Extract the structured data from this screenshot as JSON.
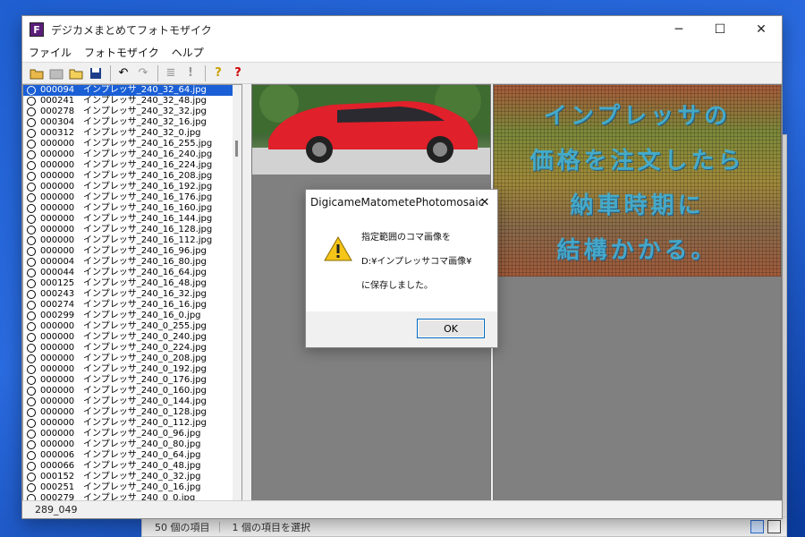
{
  "background": {
    "status_count": "50 個の項目",
    "status_selected": "1 個の項目を選択"
  },
  "window": {
    "title": "デジカメまとめてフォトモザイク",
    "icon_letter": "F"
  },
  "menu": [
    "ファイル",
    "フォトモザイク",
    "ヘルプ"
  ],
  "toolbar_icons": [
    "open-folder-icon",
    "image-folder-icon",
    "folder-icon",
    "save-icon",
    "undo-icon",
    "redo-icon",
    "list-icon",
    "exclamation-icon",
    "help-icon",
    "context-help-icon"
  ],
  "list": [
    {
      "num": "000094",
      "name": "インプレッサ_240_32_64.jpg",
      "selected": true
    },
    {
      "num": "000241",
      "name": "インプレッサ_240_32_48.jpg"
    },
    {
      "num": "000278",
      "name": "インプレッサ_240_32_32.jpg"
    },
    {
      "num": "000304",
      "name": "インプレッサ_240_32_16.jpg"
    },
    {
      "num": "000312",
      "name": "インプレッサ_240_32_0.jpg"
    },
    {
      "num": "000000",
      "name": "インプレッサ_240_16_255.jpg"
    },
    {
      "num": "000000",
      "name": "インプレッサ_240_16_240.jpg"
    },
    {
      "num": "000000",
      "name": "インプレッサ_240_16_224.jpg"
    },
    {
      "num": "000000",
      "name": "インプレッサ_240_16_208.jpg"
    },
    {
      "num": "000000",
      "name": "インプレッサ_240_16_192.jpg"
    },
    {
      "num": "000000",
      "name": "インプレッサ_240_16_176.jpg"
    },
    {
      "num": "000000",
      "name": "インプレッサ_240_16_160.jpg"
    },
    {
      "num": "000000",
      "name": "インプレッサ_240_16_144.jpg"
    },
    {
      "num": "000000",
      "name": "インプレッサ_240_16_128.jpg"
    },
    {
      "num": "000000",
      "name": "インプレッサ_240_16_112.jpg"
    },
    {
      "num": "000000",
      "name": "インプレッサ_240_16_96.jpg"
    },
    {
      "num": "000004",
      "name": "インプレッサ_240_16_80.jpg"
    },
    {
      "num": "000044",
      "name": "インプレッサ_240_16_64.jpg"
    },
    {
      "num": "000125",
      "name": "インプレッサ_240_16_48.jpg"
    },
    {
      "num": "000243",
      "name": "インプレッサ_240_16_32.jpg"
    },
    {
      "num": "000274",
      "name": "インプレッサ_240_16_16.jpg"
    },
    {
      "num": "000299",
      "name": "インプレッサ_240_16_0.jpg"
    },
    {
      "num": "000000",
      "name": "インプレッサ_240_0_255.jpg"
    },
    {
      "num": "000000",
      "name": "インプレッサ_240_0_240.jpg"
    },
    {
      "num": "000000",
      "name": "インプレッサ_240_0_224.jpg"
    },
    {
      "num": "000000",
      "name": "インプレッサ_240_0_208.jpg"
    },
    {
      "num": "000000",
      "name": "インプレッサ_240_0_192.jpg"
    },
    {
      "num": "000000",
      "name": "インプレッサ_240_0_176.jpg"
    },
    {
      "num": "000000",
      "name": "インプレッサ_240_0_160.jpg"
    },
    {
      "num": "000000",
      "name": "インプレッサ_240_0_144.jpg"
    },
    {
      "num": "000000",
      "name": "インプレッサ_240_0_128.jpg"
    },
    {
      "num": "000000",
      "name": "インプレッサ_240_0_112.jpg"
    },
    {
      "num": "000000",
      "name": "インプレッサ_240_0_96.jpg"
    },
    {
      "num": "000000",
      "name": "インプレッサ_240_0_80.jpg"
    },
    {
      "num": "000006",
      "name": "インプレッサ_240_0_64.jpg"
    },
    {
      "num": "000066",
      "name": "インプレッサ_240_0_48.jpg"
    },
    {
      "num": "000152",
      "name": "インプレッサ_240_0_32.jpg"
    },
    {
      "num": "000251",
      "name": "インプレッサ_240_0_16.jpg"
    },
    {
      "num": "000279",
      "name": "インプレッサ_240_0_0.jpg"
    }
  ],
  "mosaic_text": [
    "インプレッサの",
    "価格を注文したら",
    "納車時期に",
    "結構かかる。"
  ],
  "status": "289_049",
  "dialog": {
    "title": "DigicameMatometePhotomosaic",
    "lines": [
      "指定範囲のコマ画像を",
      "D:¥インプレッサコマ画像¥",
      "に保存しました。"
    ],
    "ok": "OK"
  },
  "colors": {
    "selection": "#1a5fd6",
    "car_body": "#e0202a"
  }
}
